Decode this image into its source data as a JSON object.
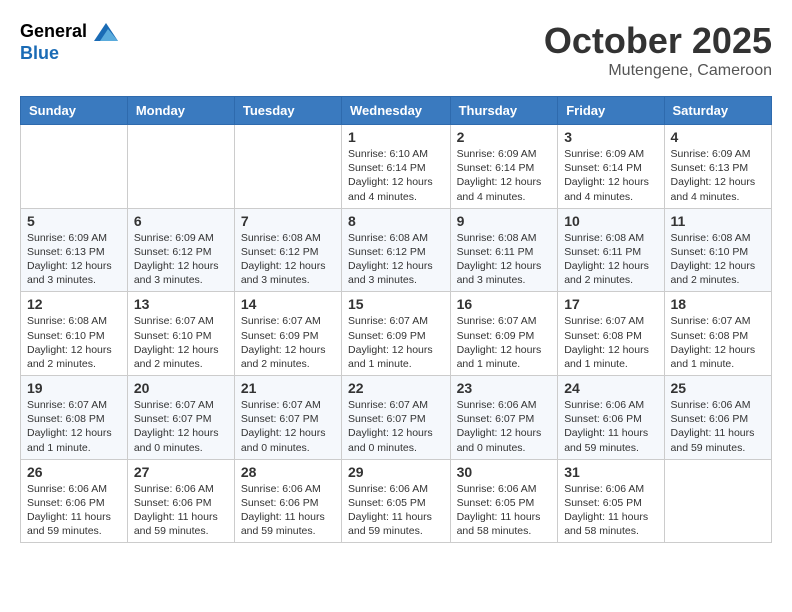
{
  "header": {
    "logo": {
      "general": "General",
      "blue": "Blue"
    },
    "title": "October 2025",
    "subtitle": "Mutengene, Cameroon"
  },
  "days_of_week": [
    "Sunday",
    "Monday",
    "Tuesday",
    "Wednesday",
    "Thursday",
    "Friday",
    "Saturday"
  ],
  "weeks": [
    [
      {
        "day": "",
        "info": ""
      },
      {
        "day": "",
        "info": ""
      },
      {
        "day": "",
        "info": ""
      },
      {
        "day": "1",
        "info": "Sunrise: 6:10 AM\nSunset: 6:14 PM\nDaylight: 12 hours\nand 4 minutes."
      },
      {
        "day": "2",
        "info": "Sunrise: 6:09 AM\nSunset: 6:14 PM\nDaylight: 12 hours\nand 4 minutes."
      },
      {
        "day": "3",
        "info": "Sunrise: 6:09 AM\nSunset: 6:14 PM\nDaylight: 12 hours\nand 4 minutes."
      },
      {
        "day": "4",
        "info": "Sunrise: 6:09 AM\nSunset: 6:13 PM\nDaylight: 12 hours\nand 4 minutes."
      }
    ],
    [
      {
        "day": "5",
        "info": "Sunrise: 6:09 AM\nSunset: 6:13 PM\nDaylight: 12 hours\nand 3 minutes."
      },
      {
        "day": "6",
        "info": "Sunrise: 6:09 AM\nSunset: 6:12 PM\nDaylight: 12 hours\nand 3 minutes."
      },
      {
        "day": "7",
        "info": "Sunrise: 6:08 AM\nSunset: 6:12 PM\nDaylight: 12 hours\nand 3 minutes."
      },
      {
        "day": "8",
        "info": "Sunrise: 6:08 AM\nSunset: 6:12 PM\nDaylight: 12 hours\nand 3 minutes."
      },
      {
        "day": "9",
        "info": "Sunrise: 6:08 AM\nSunset: 6:11 PM\nDaylight: 12 hours\nand 3 minutes."
      },
      {
        "day": "10",
        "info": "Sunrise: 6:08 AM\nSunset: 6:11 PM\nDaylight: 12 hours\nand 2 minutes."
      },
      {
        "day": "11",
        "info": "Sunrise: 6:08 AM\nSunset: 6:10 PM\nDaylight: 12 hours\nand 2 minutes."
      }
    ],
    [
      {
        "day": "12",
        "info": "Sunrise: 6:08 AM\nSunset: 6:10 PM\nDaylight: 12 hours\nand 2 minutes."
      },
      {
        "day": "13",
        "info": "Sunrise: 6:07 AM\nSunset: 6:10 PM\nDaylight: 12 hours\nand 2 minutes."
      },
      {
        "day": "14",
        "info": "Sunrise: 6:07 AM\nSunset: 6:09 PM\nDaylight: 12 hours\nand 2 minutes."
      },
      {
        "day": "15",
        "info": "Sunrise: 6:07 AM\nSunset: 6:09 PM\nDaylight: 12 hours\nand 1 minute."
      },
      {
        "day": "16",
        "info": "Sunrise: 6:07 AM\nSunset: 6:09 PM\nDaylight: 12 hours\nand 1 minute."
      },
      {
        "day": "17",
        "info": "Sunrise: 6:07 AM\nSunset: 6:08 PM\nDaylight: 12 hours\nand 1 minute."
      },
      {
        "day": "18",
        "info": "Sunrise: 6:07 AM\nSunset: 6:08 PM\nDaylight: 12 hours\nand 1 minute."
      }
    ],
    [
      {
        "day": "19",
        "info": "Sunrise: 6:07 AM\nSunset: 6:08 PM\nDaylight: 12 hours\nand 1 minute."
      },
      {
        "day": "20",
        "info": "Sunrise: 6:07 AM\nSunset: 6:07 PM\nDaylight: 12 hours\nand 0 minutes."
      },
      {
        "day": "21",
        "info": "Sunrise: 6:07 AM\nSunset: 6:07 PM\nDaylight: 12 hours\nand 0 minutes."
      },
      {
        "day": "22",
        "info": "Sunrise: 6:07 AM\nSunset: 6:07 PM\nDaylight: 12 hours\nand 0 minutes."
      },
      {
        "day": "23",
        "info": "Sunrise: 6:06 AM\nSunset: 6:07 PM\nDaylight: 12 hours\nand 0 minutes."
      },
      {
        "day": "24",
        "info": "Sunrise: 6:06 AM\nSunset: 6:06 PM\nDaylight: 11 hours\nand 59 minutes."
      },
      {
        "day": "25",
        "info": "Sunrise: 6:06 AM\nSunset: 6:06 PM\nDaylight: 11 hours\nand 59 minutes."
      }
    ],
    [
      {
        "day": "26",
        "info": "Sunrise: 6:06 AM\nSunset: 6:06 PM\nDaylight: 11 hours\nand 59 minutes."
      },
      {
        "day": "27",
        "info": "Sunrise: 6:06 AM\nSunset: 6:06 PM\nDaylight: 11 hours\nand 59 minutes."
      },
      {
        "day": "28",
        "info": "Sunrise: 6:06 AM\nSunset: 6:06 PM\nDaylight: 11 hours\nand 59 minutes."
      },
      {
        "day": "29",
        "info": "Sunrise: 6:06 AM\nSunset: 6:05 PM\nDaylight: 11 hours\nand 59 minutes."
      },
      {
        "day": "30",
        "info": "Sunrise: 6:06 AM\nSunset: 6:05 PM\nDaylight: 11 hours\nand 58 minutes."
      },
      {
        "day": "31",
        "info": "Sunrise: 6:06 AM\nSunset: 6:05 PM\nDaylight: 11 hours\nand 58 minutes."
      },
      {
        "day": "",
        "info": ""
      }
    ]
  ]
}
